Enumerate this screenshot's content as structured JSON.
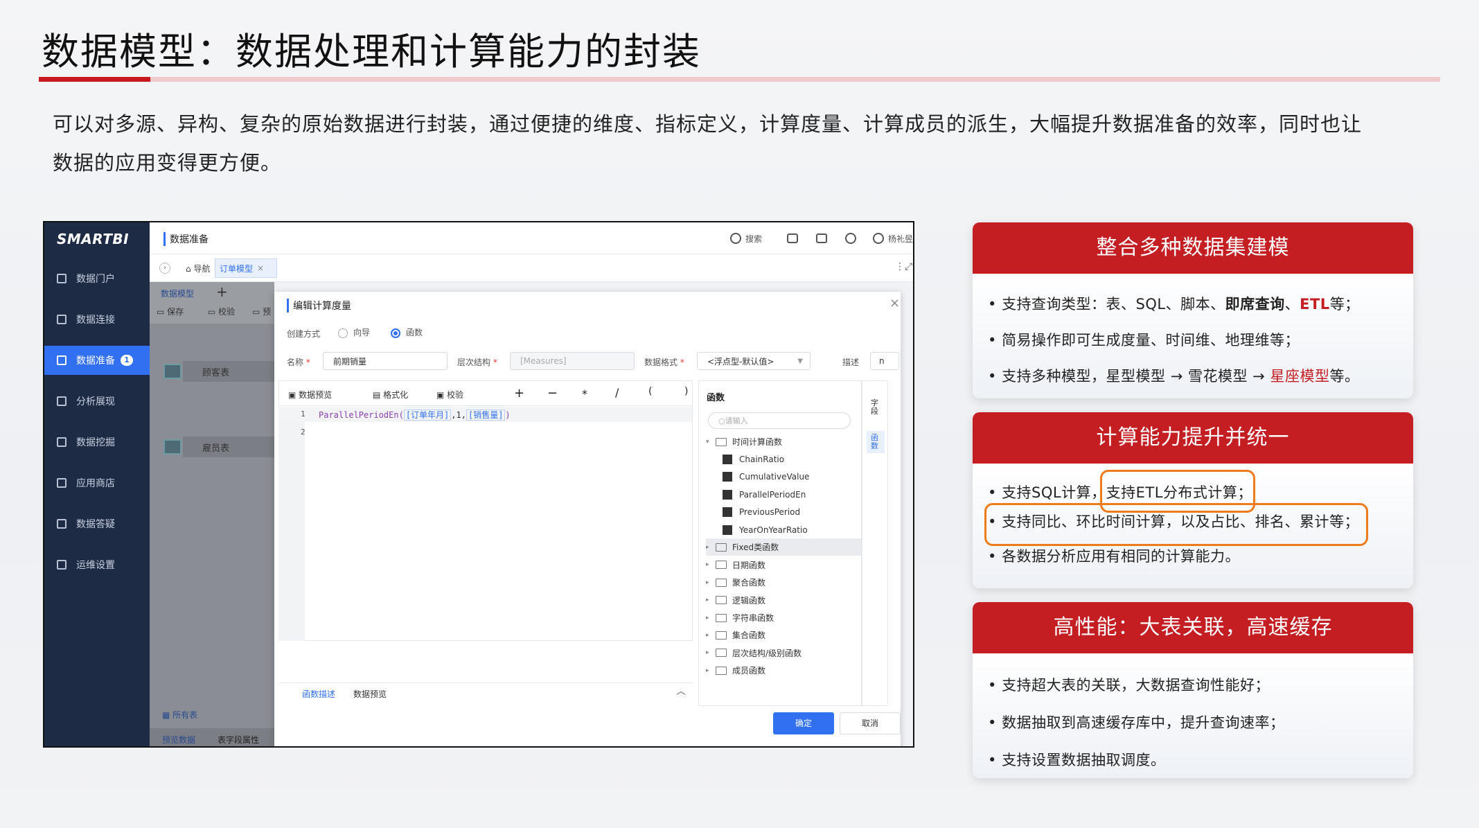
{
  "title": "数据模型：数据处理和计算能力的封装",
  "intro": {
    "line1": "可以对多源、异构、复杂的原始数据进行封装，通过便捷的维度、指标定义，计算度量、计算成员的派生，大幅提升数据准备的效率，同时也让",
    "line2": "数据的应用变得更方便。"
  },
  "app": {
    "logo": "SMARTBI",
    "nav": [
      {
        "label": "数据门户",
        "icon": "portal-icon"
      },
      {
        "label": "数据连接",
        "icon": "database-icon"
      },
      {
        "label": "数据准备",
        "icon": "prepare-icon",
        "badge": "1"
      },
      {
        "label": "分析展现",
        "icon": "bar-chart-icon"
      },
      {
        "label": "数据挖掘",
        "icon": "mining-icon"
      },
      {
        "label": "应用商店",
        "icon": "grid-icon"
      },
      {
        "label": "数据答疑",
        "icon": "question-icon"
      },
      {
        "label": "运维设置",
        "icon": "gear-icon"
      }
    ],
    "topbar": {
      "title": "数据准备",
      "search": "搜索",
      "user": "杨礼昱",
      "more": "···"
    },
    "tabbar": {
      "nav": "导航",
      "tab": "订单模型",
      "tab_close": "×"
    },
    "model": {
      "tab": "数据模型",
      "add": "+",
      "save": "保存",
      "check": "校验",
      "extra": "预",
      "table1": "顾客表",
      "table2": "雇员表",
      "all_tables": "所有表",
      "preview": "预览数据",
      "props": "表字段属性"
    },
    "dialog": {
      "title": "编辑计算度量",
      "close": "×",
      "mode_label": "创建方式",
      "mode_wizard": "向导",
      "mode_func": "函数",
      "name_label": "名称",
      "name_value": "前期销量",
      "hier_label": "层次结构",
      "hier_value": "[Measures]",
      "fmt_label": "数据格式",
      "fmt_value": "<浮点型-默认值>",
      "desc_label": "描述",
      "desc_value": "n",
      "toolbar": {
        "preview": "数据预览",
        "format": "格式化",
        "check": "校验",
        "ops": [
          "+",
          "−",
          "*",
          "/",
          "(",
          ")"
        ]
      },
      "code": {
        "fn": "ParallelPeriodEn(",
        "arg1": "[订单年月]",
        "mid": ",1,",
        "arg2": "[销售量]",
        "end": ")",
        "lines": [
          "1",
          "2"
        ]
      },
      "bottom_tabs": [
        "函数描述",
        "数据预览"
      ],
      "fn_panel": {
        "title": "函数",
        "search_placeholder": "请输入",
        "side_tabs": [
          "字段",
          "函数"
        ],
        "tree": [
          {
            "label": "时间计算函数",
            "type": "folder",
            "open": true
          },
          {
            "label": "ChainRatio",
            "type": "fn"
          },
          {
            "label": "CumulativeValue",
            "type": "fn"
          },
          {
            "label": "ParallelPeriodEn",
            "type": "fn"
          },
          {
            "label": "PreviousPeriod",
            "type": "fn"
          },
          {
            "label": "YearOnYearRatio",
            "type": "fn"
          },
          {
            "label": "Fixed类函数",
            "type": "folder",
            "selected": true
          },
          {
            "label": "日期函数",
            "type": "folder"
          },
          {
            "label": "聚合函数",
            "type": "folder"
          },
          {
            "label": "逻辑函数",
            "type": "folder"
          },
          {
            "label": "字符串函数",
            "type": "folder"
          },
          {
            "label": "集合函数",
            "type": "folder"
          },
          {
            "label": "层次结构/级别函数",
            "type": "folder"
          },
          {
            "label": "成员函数",
            "type": "folder"
          }
        ]
      },
      "ok": "确定",
      "cancel": "取消"
    }
  },
  "cards": [
    {
      "title": "整合多种数据集建模",
      "bullets": [
        {
          "p": "支持查询类型：表、SQL、脚本、",
          "b": "即席查询",
          "m": "、",
          "r": "ETL",
          "e": "等；"
        },
        {
          "p": "简易操作即可生成度量、时间维、地理维等；"
        },
        {
          "p": "支持多种模型，星型模型 → 雪花模型 → ",
          "r": "星座模型",
          "e": "等。"
        }
      ]
    },
    {
      "title": "计算能力提升并统一",
      "bullets": [
        {
          "p": "支持SQL计算，",
          "h": "支持ETL分布式计算；"
        },
        {
          "p": "支持同比、环比时间计算，以及占比、排名、累计等；"
        },
        {
          "p": "各数据分析应用有相同的计算能力。"
        }
      ]
    },
    {
      "title": "高性能：大表关联，高速缓存",
      "bullets": [
        {
          "p": "支持超大表的关联，大数据查询性能好；"
        },
        {
          "p": "数据抽取到高速缓存库中，提升查询速率；"
        },
        {
          "p": "支持设置数据抽取调度。"
        }
      ]
    }
  ],
  "colors": {
    "brand_red": "#c41d22",
    "highlight_orange": "#ee7a1a",
    "app_blue": "#3170f1",
    "sidebar": "#1e2b45"
  }
}
